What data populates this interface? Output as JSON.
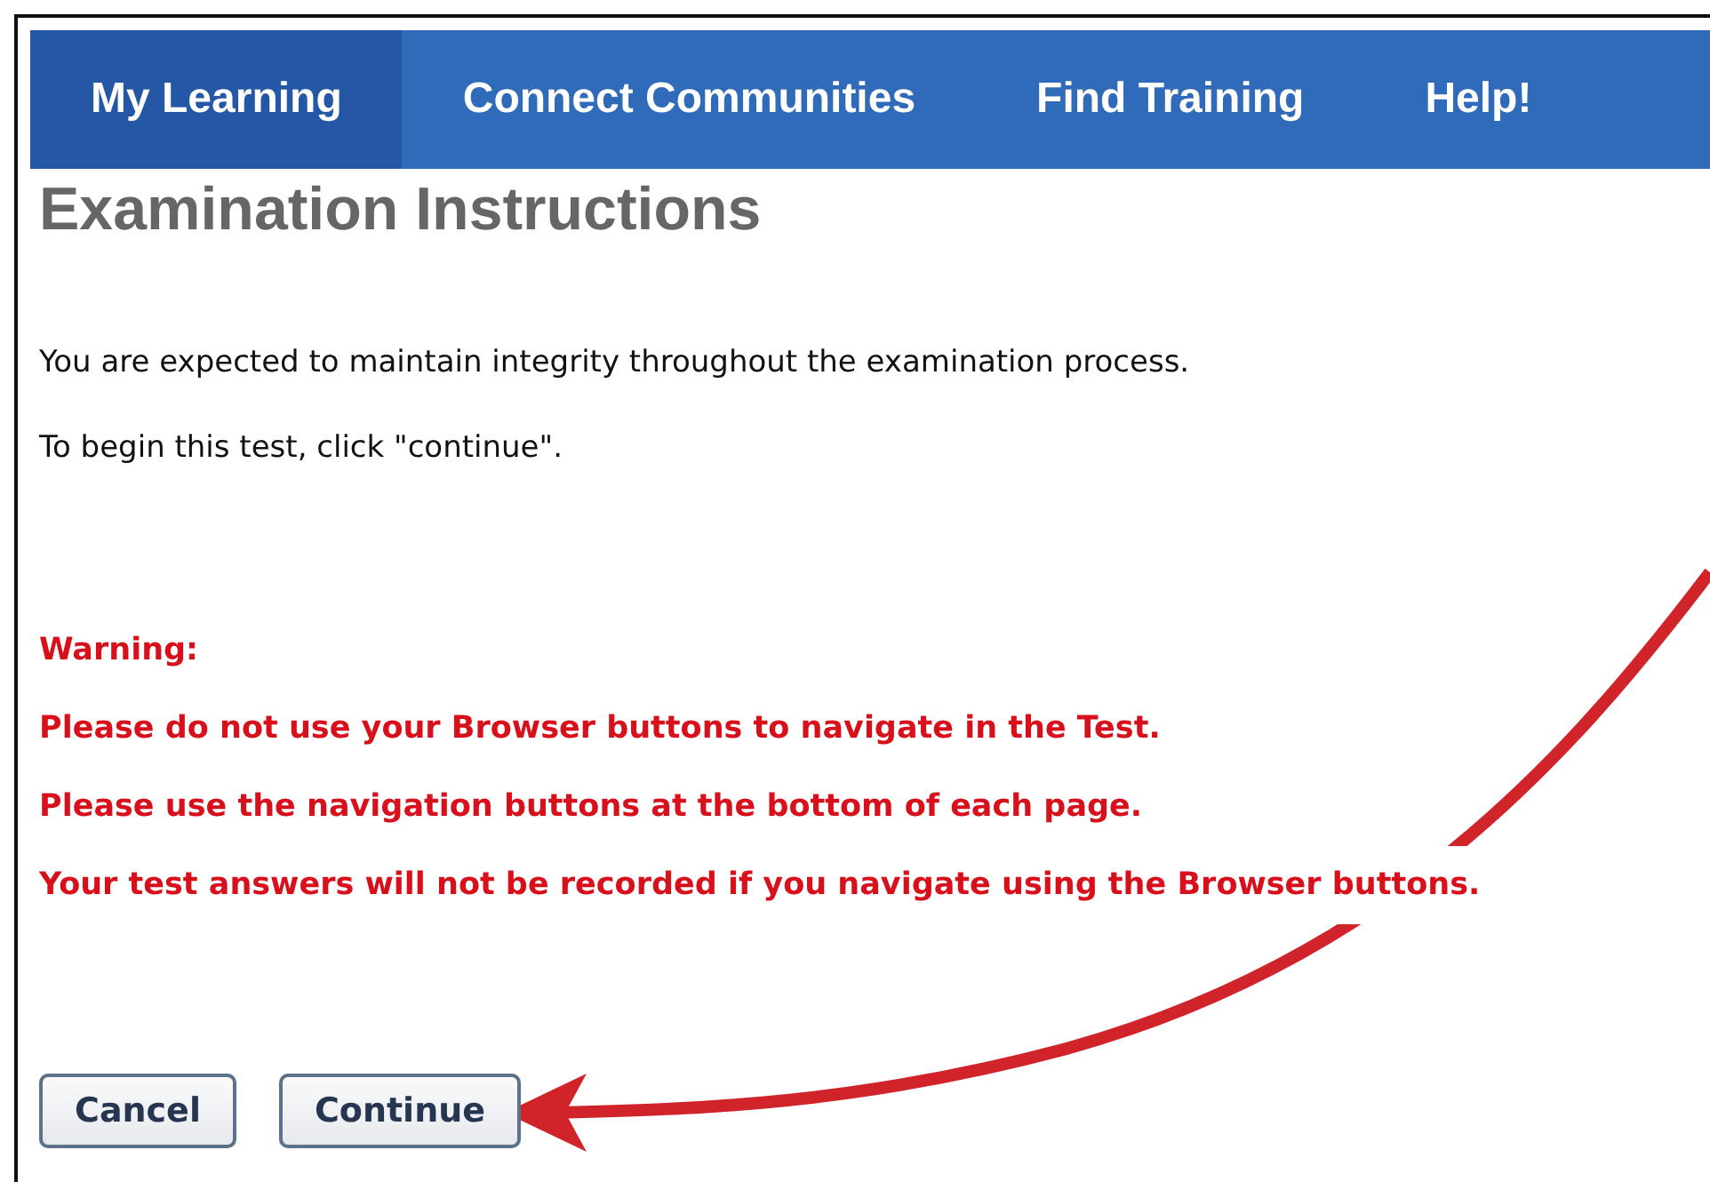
{
  "nav": {
    "tabs": [
      {
        "label": "My Learning",
        "selected": true
      },
      {
        "label": "Connect Communities",
        "selected": false
      },
      {
        "label": "Find Training",
        "selected": false
      },
      {
        "label": "Help!",
        "selected": false
      }
    ]
  },
  "page": {
    "title": "Examination Instructions",
    "paragraphs": [
      "You are expected to maintain integrity throughout the examination process.",
      "To begin this test, click \"continue\"."
    ],
    "warning": {
      "heading": "Warning:",
      "lines": [
        "Please do not use your Browser buttons to navigate in the Test.",
        "Please use the navigation buttons at the bottom of each page.",
        "Your test answers will not be recorded if you navigate using the Browser buttons."
      ]
    },
    "buttons": [
      {
        "label": "Cancel"
      },
      {
        "label": "Continue"
      }
    ]
  }
}
